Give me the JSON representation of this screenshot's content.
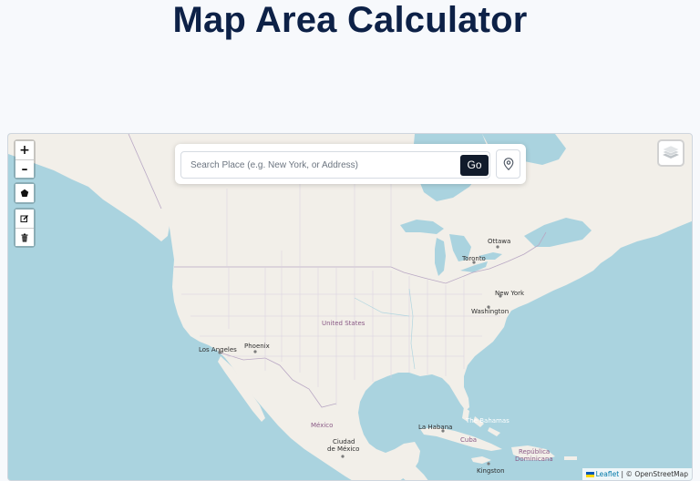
{
  "header": {
    "title": "Map Area Calculator"
  },
  "search": {
    "placeholder": "Search Place (e.g. New York, or Address)",
    "value": "",
    "go_label": "Go",
    "locate_icon": "map-pin-icon"
  },
  "controls": {
    "zoom_in": "+",
    "zoom_out": "–",
    "draw_polygon_icon": "polygon-icon",
    "edit_icon": "edit-icon",
    "delete_icon": "trash-icon",
    "layers_icon": "layers-icon"
  },
  "map": {
    "labels": {
      "ottawa": "Ottawa",
      "toronto": "Toronto",
      "new_york": "New York",
      "washington": "Washington",
      "united_states": "United States",
      "los_angeles": "Los Angeles",
      "phoenix": "Phoenix",
      "mexico": "México",
      "ciudad_de_mexico_1": "Ciudad",
      "ciudad_de_mexico_2": "de México",
      "la_habana": "La Habana",
      "the_bahamas": "The Bahamas",
      "cuba": "Cuba",
      "republica_dominicana_1": "República",
      "republica_dominicana_2": "Dominicana",
      "kingston": "Kingston"
    },
    "colors": {
      "water": "#aad3df",
      "land": "#f2efe9",
      "border": "#b9a8c4"
    }
  },
  "attribution": {
    "leaflet": "Leaflet",
    "separator": " | © ",
    "osm": "OpenStreetMap"
  }
}
